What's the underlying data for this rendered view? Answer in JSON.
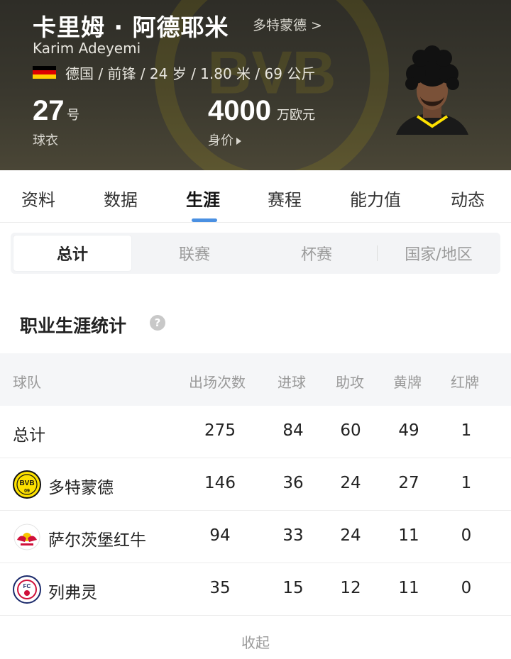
{
  "player": {
    "name_cn": "卡里姆 · 阿德耶米",
    "name_en": "Karim Adeyemi",
    "club_link": "多特蒙德 >",
    "info": "德国 / 前锋 / 24 岁 / 1.80 米 / 69 公斤",
    "jersey_number": "27",
    "jersey_unit": "号",
    "jersey_label": "球衣",
    "market_value": "4000",
    "market_value_unit": "万欧元",
    "market_value_label": "身价"
  },
  "flag_colors": [
    "#000000",
    "#dd0000",
    "#ffce00"
  ],
  "tabs": [
    {
      "label": "资料"
    },
    {
      "label": "数据"
    },
    {
      "label": "生涯",
      "active": true
    },
    {
      "label": "赛程"
    },
    {
      "label": "能力值"
    },
    {
      "label": "动态"
    }
  ],
  "segments": [
    {
      "label": "总计",
      "active": true
    },
    {
      "label": "联赛"
    },
    {
      "label": "杯赛"
    },
    {
      "label": "国家/地区"
    }
  ],
  "section_title": "职业生涯统计",
  "help_icon": "question-icon",
  "table": {
    "headers": [
      "球队",
      "出场次数",
      "进球",
      "助攻",
      "黄牌",
      "红牌"
    ],
    "rows": [
      {
        "team": "总计",
        "logo": "",
        "apps": "275",
        "goals": "84",
        "assists": "60",
        "yellow": "49",
        "red": "1"
      },
      {
        "team": "多特蒙德",
        "logo": "bvb-logo",
        "apps": "146",
        "goals": "36",
        "assists": "24",
        "yellow": "27",
        "red": "1"
      },
      {
        "team": "萨尔茨堡红牛",
        "logo": "red-bull-salzburg-logo",
        "apps": "94",
        "goals": "33",
        "assists": "24",
        "yellow": "11",
        "red": "0"
      },
      {
        "team": "列弗灵",
        "logo": "fc-liefering-logo",
        "apps": "35",
        "goals": "15",
        "assists": "12",
        "yellow": "11",
        "red": "0"
      }
    ]
  },
  "collapse_label": "收起",
  "colors": {
    "accent": "#4a90e2",
    "bvb_yellow": "#fde100",
    "header_bg": "#3a382e"
  }
}
